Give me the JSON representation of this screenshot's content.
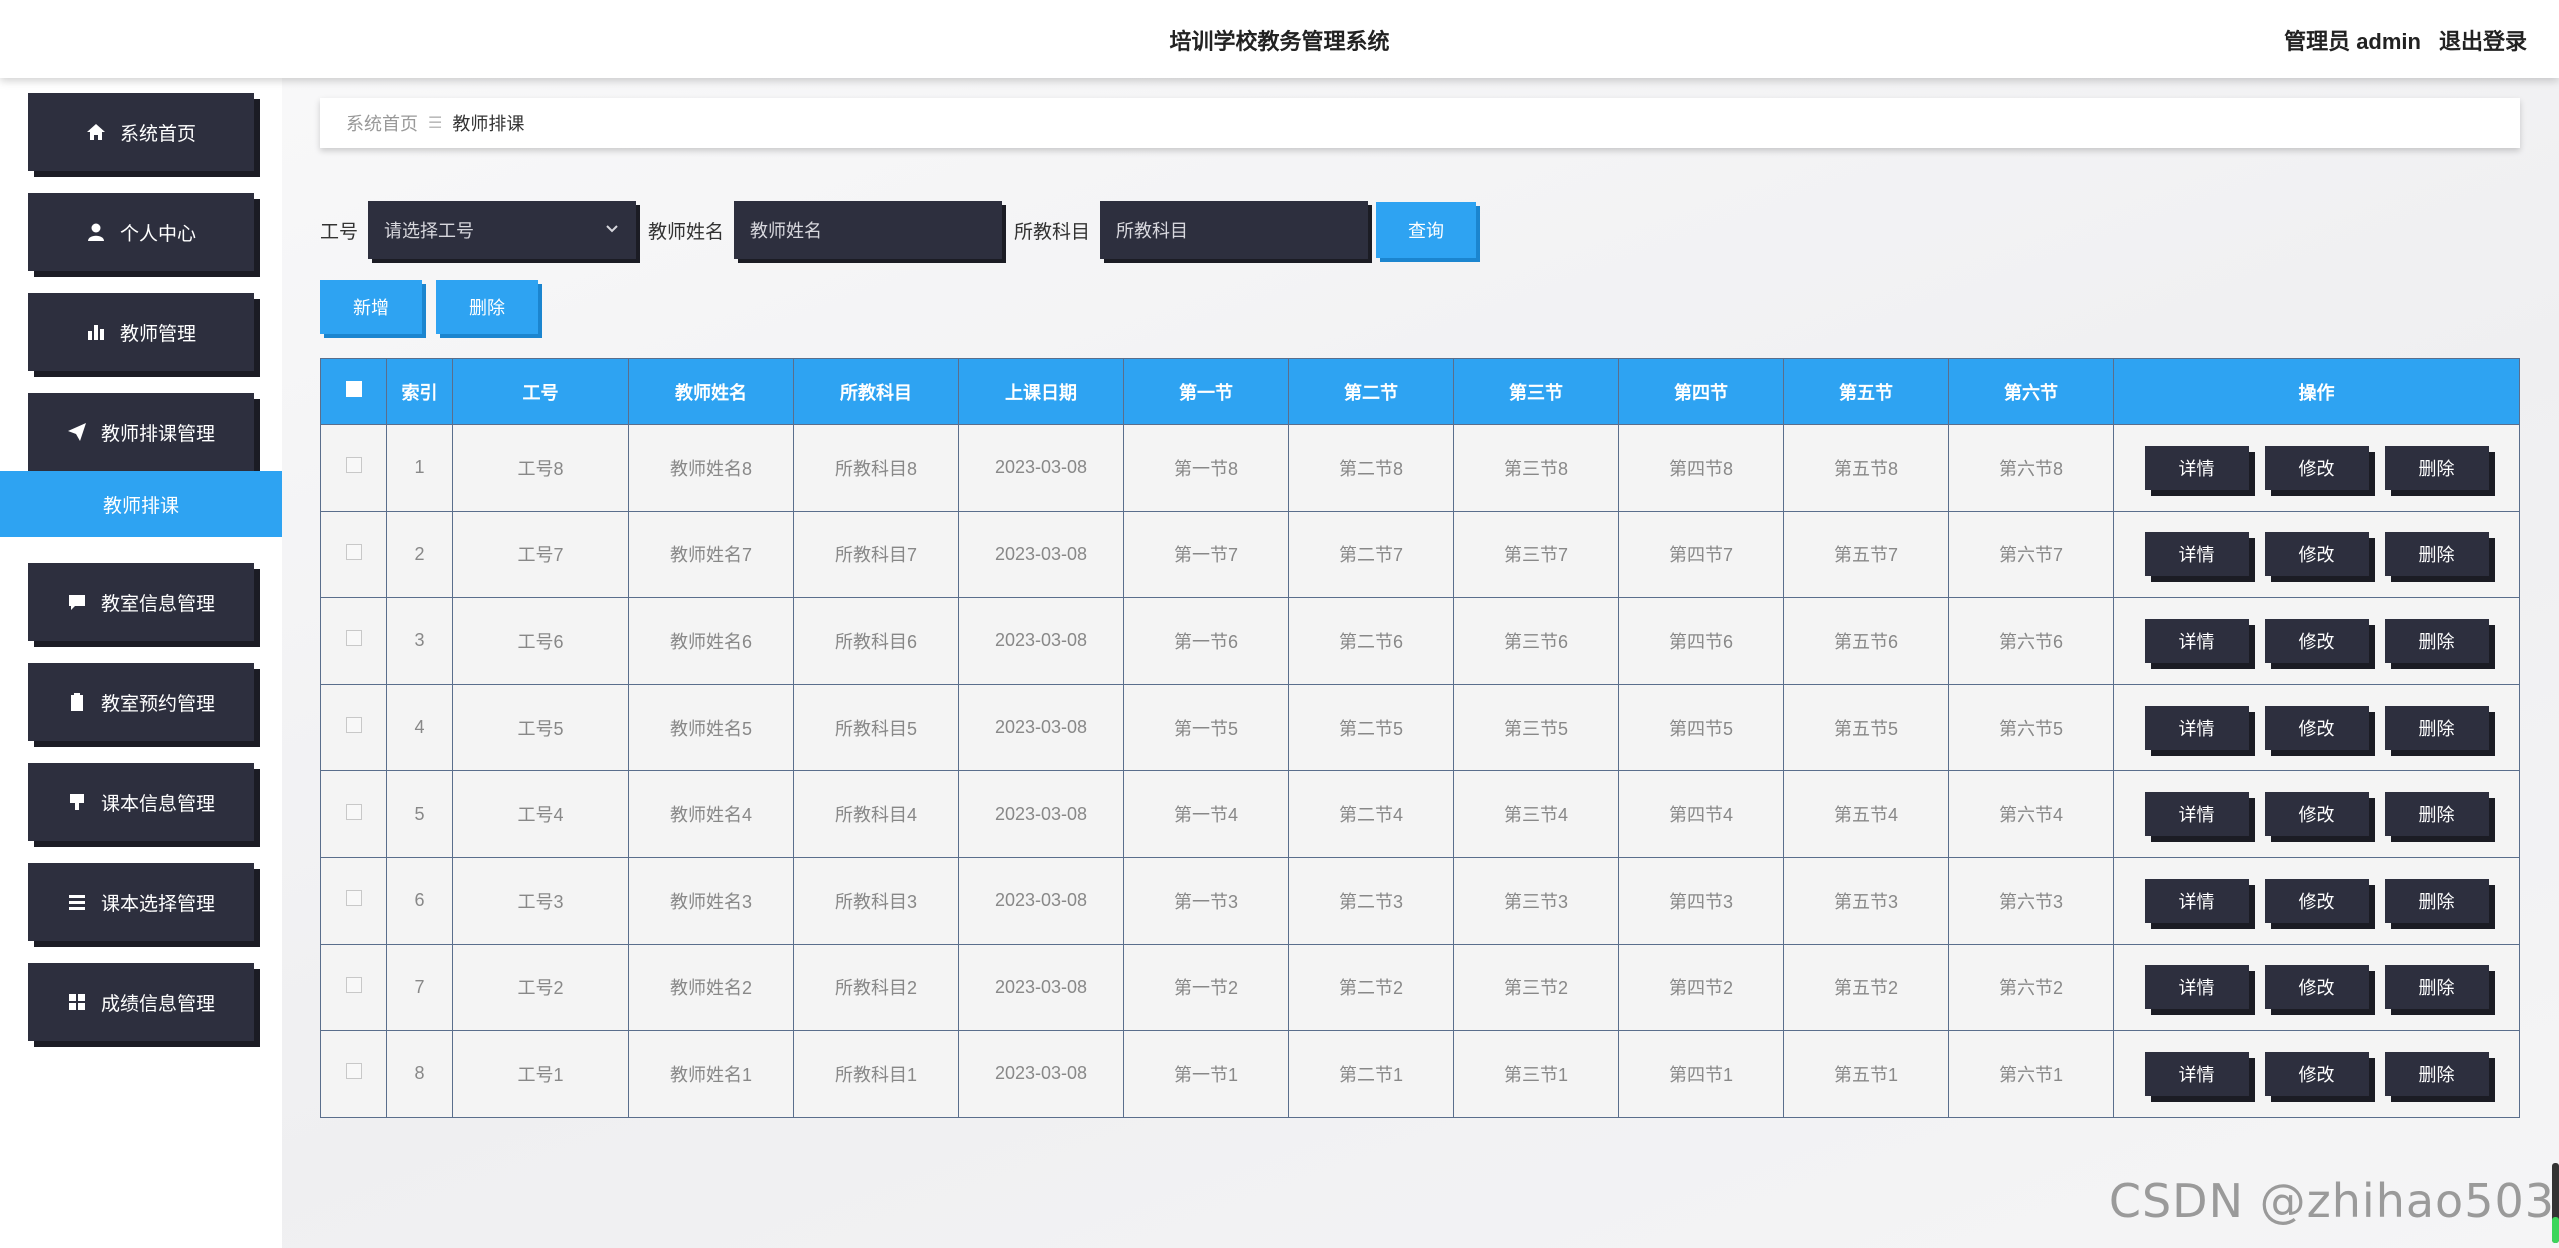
{
  "header": {
    "title": "培训学校教务管理系统",
    "user": "管理员 admin",
    "logout": "退出登录"
  },
  "sidebar": {
    "items": [
      {
        "label": "系统首页",
        "icon": "home-icon"
      },
      {
        "label": "个人中心",
        "icon": "user-icon"
      },
      {
        "label": "教师管理",
        "icon": "bar-chart-icon"
      },
      {
        "label": "教师排课管理",
        "icon": "paper-plane-icon"
      },
      {
        "label": "教室信息管理",
        "icon": "comment-icon"
      },
      {
        "label": "教室预约管理",
        "icon": "clipboard-icon"
      },
      {
        "label": "课本信息管理",
        "icon": "presentation-icon"
      },
      {
        "label": "课本选择管理",
        "icon": "list-icon"
      },
      {
        "label": "成绩信息管理",
        "icon": "grid-icon"
      }
    ],
    "active_sub": "教师排课"
  },
  "breadcrumb": {
    "home": "系统首页",
    "sep": "☰",
    "current": "教师排课"
  },
  "search": {
    "gh_label": "工号",
    "gh_placeholder": "请选择工号",
    "name_label": "教师姓名",
    "name_placeholder": "教师姓名",
    "subject_label": "所教科目",
    "subject_placeholder": "所教科目",
    "query": "查询"
  },
  "actions": {
    "add": "新增",
    "delete": "删除"
  },
  "table": {
    "headers": [
      "索引",
      "工号",
      "教师姓名",
      "所教科目",
      "上课日期",
      "第一节",
      "第二节",
      "第三节",
      "第四节",
      "第五节",
      "第六节",
      "操作"
    ],
    "op_labels": {
      "detail": "详情",
      "edit": "修改",
      "delete": "删除"
    },
    "rows": [
      [
        "1",
        "工号8",
        "教师姓名8",
        "所教科目8",
        "2023-03-08",
        "第一节8",
        "第二节8",
        "第三节8",
        "第四节8",
        "第五节8",
        "第六节8"
      ],
      [
        "2",
        "工号7",
        "教师姓名7",
        "所教科目7",
        "2023-03-08",
        "第一节7",
        "第二节7",
        "第三节7",
        "第四节7",
        "第五节7",
        "第六节7"
      ],
      [
        "3",
        "工号6",
        "教师姓名6",
        "所教科目6",
        "2023-03-08",
        "第一节6",
        "第二节6",
        "第三节6",
        "第四节6",
        "第五节6",
        "第六节6"
      ],
      [
        "4",
        "工号5",
        "教师姓名5",
        "所教科目5",
        "2023-03-08",
        "第一节5",
        "第二节5",
        "第三节5",
        "第四节5",
        "第五节5",
        "第六节5"
      ],
      [
        "5",
        "工号4",
        "教师姓名4",
        "所教科目4",
        "2023-03-08",
        "第一节4",
        "第二节4",
        "第三节4",
        "第四节4",
        "第五节4",
        "第六节4"
      ],
      [
        "6",
        "工号3",
        "教师姓名3",
        "所教科目3",
        "2023-03-08",
        "第一节3",
        "第二节3",
        "第三节3",
        "第四节3",
        "第五节3",
        "第六节3"
      ],
      [
        "7",
        "工号2",
        "教师姓名2",
        "所教科目2",
        "2023-03-08",
        "第一节2",
        "第二节2",
        "第三节2",
        "第四节2",
        "第五节2",
        "第六节2"
      ],
      [
        "8",
        "工号1",
        "教师姓名1",
        "所教科目1",
        "2023-03-08",
        "第一节1",
        "第二节1",
        "第三节1",
        "第四节1",
        "第五节1",
        "第六节1"
      ]
    ]
  },
  "watermark": "CSDN @zhihao503",
  "colors": {
    "accent": "#2ea3f2",
    "dark": "#2d2f3e"
  }
}
